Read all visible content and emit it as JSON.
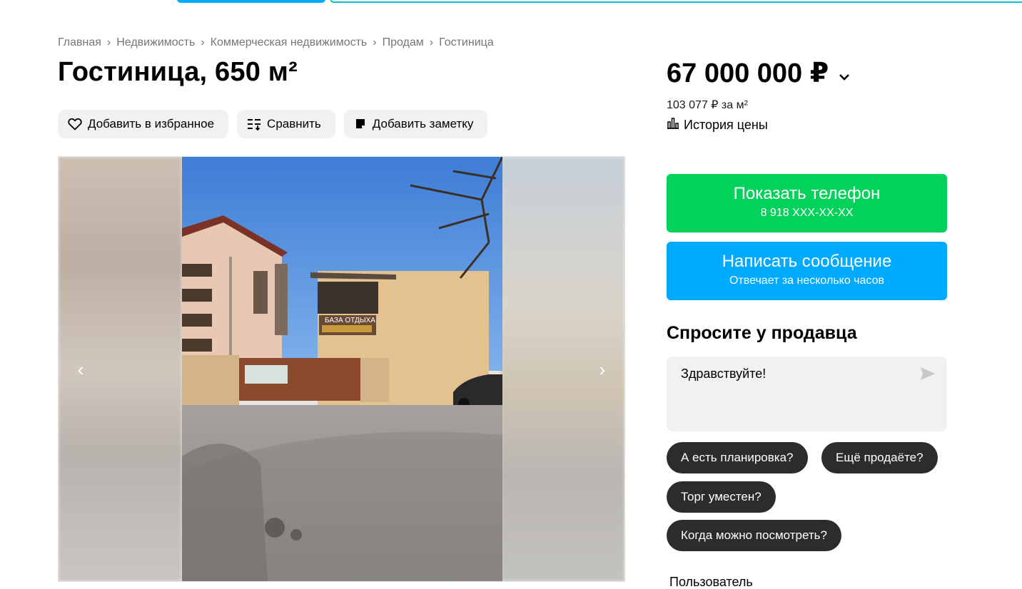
{
  "breadcrumb": [
    "Главная",
    "Недвижимость",
    "Коммерческая недвижимость",
    "Продам",
    "Гостиница"
  ],
  "title": "Гостиница, 650 м²",
  "actions": {
    "favorite": "Добавить в избранное",
    "compare": "Сравнить",
    "note": "Добавить заметку"
  },
  "gallery": {
    "prev_arrow": "‹",
    "next_arrow": "›",
    "photo_sign_lines": [
      "БАЗА ОТДЫХА"
    ]
  },
  "price": {
    "value": "67 000 000 ₽",
    "per_m2": "103 077 ₽ за м²",
    "history_label": "История цены"
  },
  "contact": {
    "phone_label": "Показать телефон",
    "phone_number": "8 918 XXX-XX-XX",
    "message_label": "Написать сообщение",
    "message_sub": "Отвечает за несколько часов"
  },
  "ask_seller": {
    "title": "Спросите у продавца",
    "message": "Здравствуйте!",
    "chips": [
      "А есть планировка?",
      "Ещё продаёте?",
      "Торг уместен?",
      "Когда можно посмотреть?"
    ]
  },
  "seller": {
    "label": "Пользователь"
  },
  "colors": {
    "green": "#02d15c",
    "blue": "#00aaff",
    "chip_bg": "#2c2c2c",
    "button_bg": "#f2f1f0"
  }
}
